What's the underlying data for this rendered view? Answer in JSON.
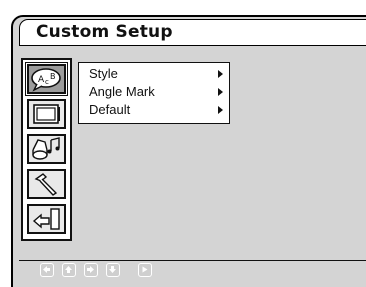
{
  "window": {
    "title": "Custom Setup"
  },
  "sidebar": {
    "items": [
      {
        "icon": "abc-speech-bubble-icon",
        "selected": true
      },
      {
        "icon": "tv-screen-icon",
        "selected": false
      },
      {
        "icon": "speaker-music-icon",
        "selected": false
      },
      {
        "icon": "hammer-icon",
        "selected": false
      },
      {
        "icon": "exit-door-icon",
        "selected": false
      }
    ]
  },
  "menu": {
    "items": [
      {
        "label": "Style"
      },
      {
        "label": "Angle Mark"
      },
      {
        "label": "Default"
      }
    ]
  },
  "footer": {
    "buttons": [
      {
        "icon": "arrow-left-icon"
      },
      {
        "icon": "arrow-up-icon"
      },
      {
        "icon": "arrow-right-icon"
      },
      {
        "icon": "arrow-down-icon"
      },
      {
        "icon": "play-icon"
      }
    ]
  },
  "colors": {
    "panel_background": "#d4d4d4",
    "selected_icon_background": "#9c9c9c",
    "border": "#111111"
  }
}
